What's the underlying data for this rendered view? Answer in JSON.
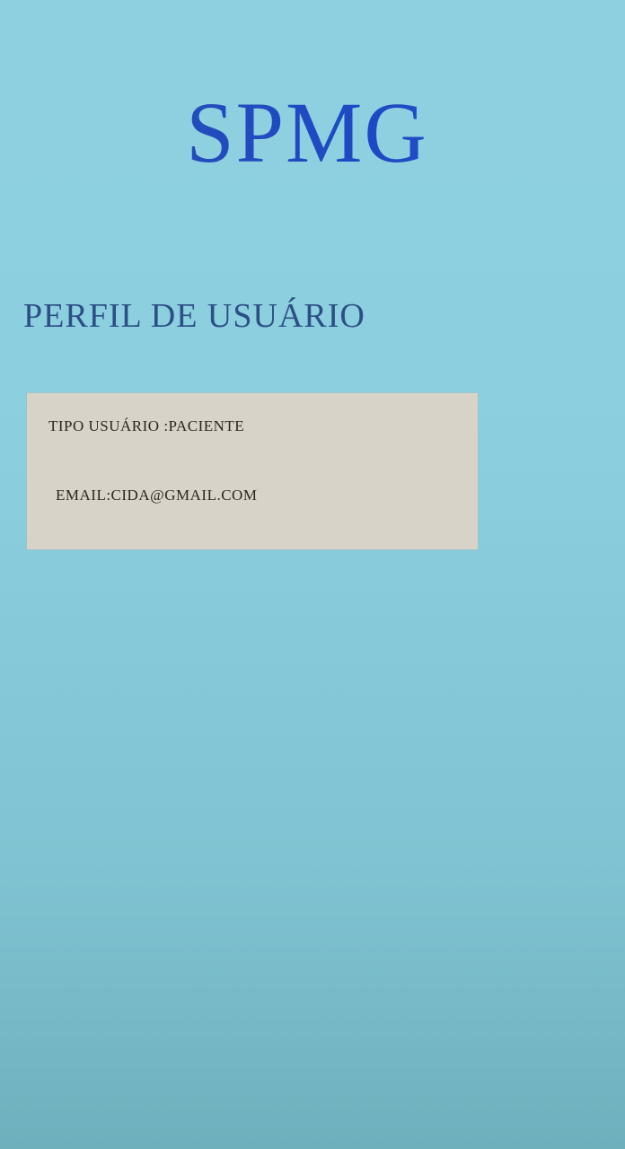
{
  "app": {
    "title": "SPMG"
  },
  "page": {
    "title": "PERFIL DE USUÁRIO"
  },
  "profile": {
    "user_type": "TIPO USUÁRIO :PACIENTE",
    "email": "EMAIL:CIDA@GMAIL.COM"
  },
  "colors": {
    "background": "#8bcfdf",
    "title": "#2248b8",
    "heading": "#2d4f86",
    "card": "#d8d3c9",
    "card_text": "#2b2622"
  }
}
